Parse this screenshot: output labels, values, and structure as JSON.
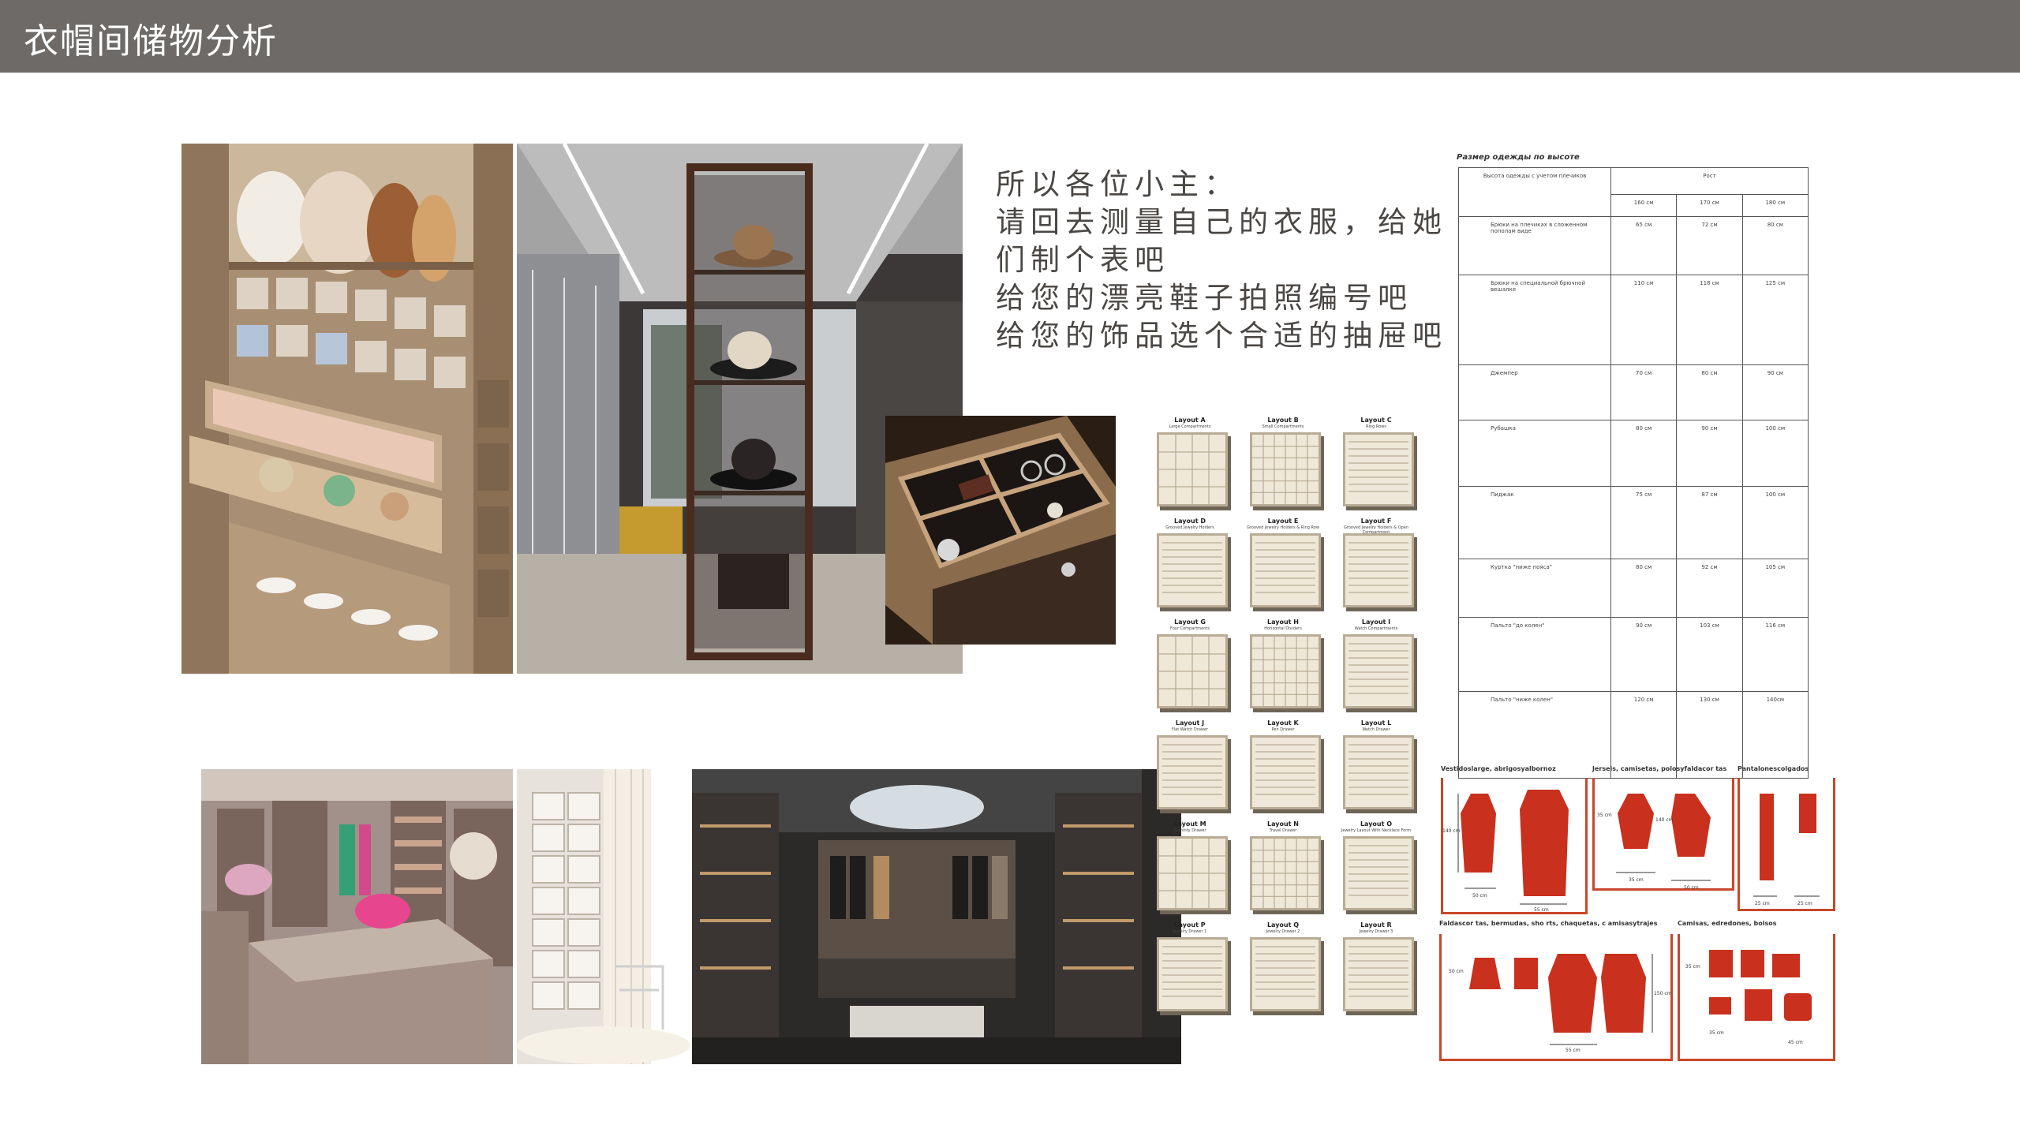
{
  "header": {
    "title": "衣帽间储物分析"
  },
  "note": {
    "lines": [
      "所以各位小主：",
      "请回去测量自己的衣服，给她",
      "们制个表吧",
      "给您的漂亮鞋子拍照编号吧",
      "给您的饰品选个合适的抽屉吧"
    ]
  },
  "colors": {
    "header_bg": "#6d6a68",
    "garment_red": "#c9472a",
    "text_brown": "#4a4744"
  },
  "drawer_layouts": [
    {
      "label": "Layout A",
      "sub": "Large Compartments"
    },
    {
      "label": "Layout B",
      "sub": "Small Compartments"
    },
    {
      "label": "Layout C",
      "sub": "Ring Rows"
    },
    {
      "label": "Layout D",
      "sub": "Grooved Jewelry Holders"
    },
    {
      "label": "Layout E",
      "sub": "Grooved Jewelry Holders & Ring Row"
    },
    {
      "label": "Layout F",
      "sub": "Grooved Jewelry Holders & Open Compartment"
    },
    {
      "label": "Layout G",
      "sub": "Four Compartments"
    },
    {
      "label": "Layout H",
      "sub": "Horizontal Dividers"
    },
    {
      "label": "Layout I",
      "sub": "Watch Compartments"
    },
    {
      "label": "Layout J",
      "sub": "Flat Watch Drawer"
    },
    {
      "label": "Layout K",
      "sub": "Pen Drawer"
    },
    {
      "label": "Layout L",
      "sub": "Watch Drawer"
    },
    {
      "label": "Layout M",
      "sub": "Cuminty Drawer"
    },
    {
      "label": "Layout N",
      "sub": "Travel Drawer"
    },
    {
      "label": "Layout O",
      "sub": "Jewelry Layout With Necklace Form"
    },
    {
      "label": "Layout P",
      "sub": "Jewelry Drawer 1"
    },
    {
      "label": "Layout Q",
      "sub": "Jewelry Drawer 2"
    },
    {
      "label": "Layout R",
      "sub": "Jewelry Drawer 3"
    }
  ],
  "size_table": {
    "caption": "Размер одежды по высоте",
    "col_header": "Высота одежды с учетом плечиков",
    "height_header": "Рост",
    "heights": [
      "160 см",
      "170 см",
      "180 см"
    ],
    "rows": [
      {
        "name": "Брюки на плечиках в сложенном пополам виде",
        "v": [
          "65 см",
          "72 см",
          "80 см"
        ]
      },
      {
        "name": "Брюки на специальной брючной вешалке",
        "v": [
          "110 см",
          "118 см",
          "125 см"
        ]
      },
      {
        "name": "Джемпер",
        "v": [
          "70 см",
          "80 см",
          "90 см"
        ]
      },
      {
        "name": "Рубашка",
        "v": [
          "80 см",
          "90 см",
          "100 см"
        ]
      },
      {
        "name": "Пиджак",
        "v": [
          "75 см",
          "87 см",
          "100 см"
        ]
      },
      {
        "name": "Куртка \"ниже пояса\"",
        "v": [
          "80 см",
          "92 см",
          "105 см"
        ]
      },
      {
        "name": "Пальто \"до колен\"",
        "v": [
          "90 см",
          "103 см",
          "116 см"
        ]
      },
      {
        "name": "Пальто \"ниже колен\"",
        "v": [
          "120 см",
          "130 см",
          "140см"
        ]
      }
    ]
  },
  "garment_panels": [
    {
      "title": "Vestidoslarge, abrigosyalbornoz",
      "dims": [
        "140 cm",
        "50 cm",
        "55 cm"
      ]
    },
    {
      "title": "Jerseis, camisetas, polosyfaldacor tas",
      "dims": [
        "35 cm",
        "140 cm",
        "35 cm",
        "50 cm"
      ]
    },
    {
      "title": "Pantalonescolgados",
      "dims": [
        "25 cm",
        "25 cm"
      ]
    },
    {
      "title": "Faldascor tas, bermudas, sho rts, chaquetas, c amisasytrajes",
      "dims": [
        "50 cm",
        "150 cm",
        "55 cm"
      ]
    },
    {
      "title": "Camisas, edredones, bolsos",
      "dims": [
        "35 cm",
        "35 cm",
        "45 cm"
      ]
    }
  ]
}
